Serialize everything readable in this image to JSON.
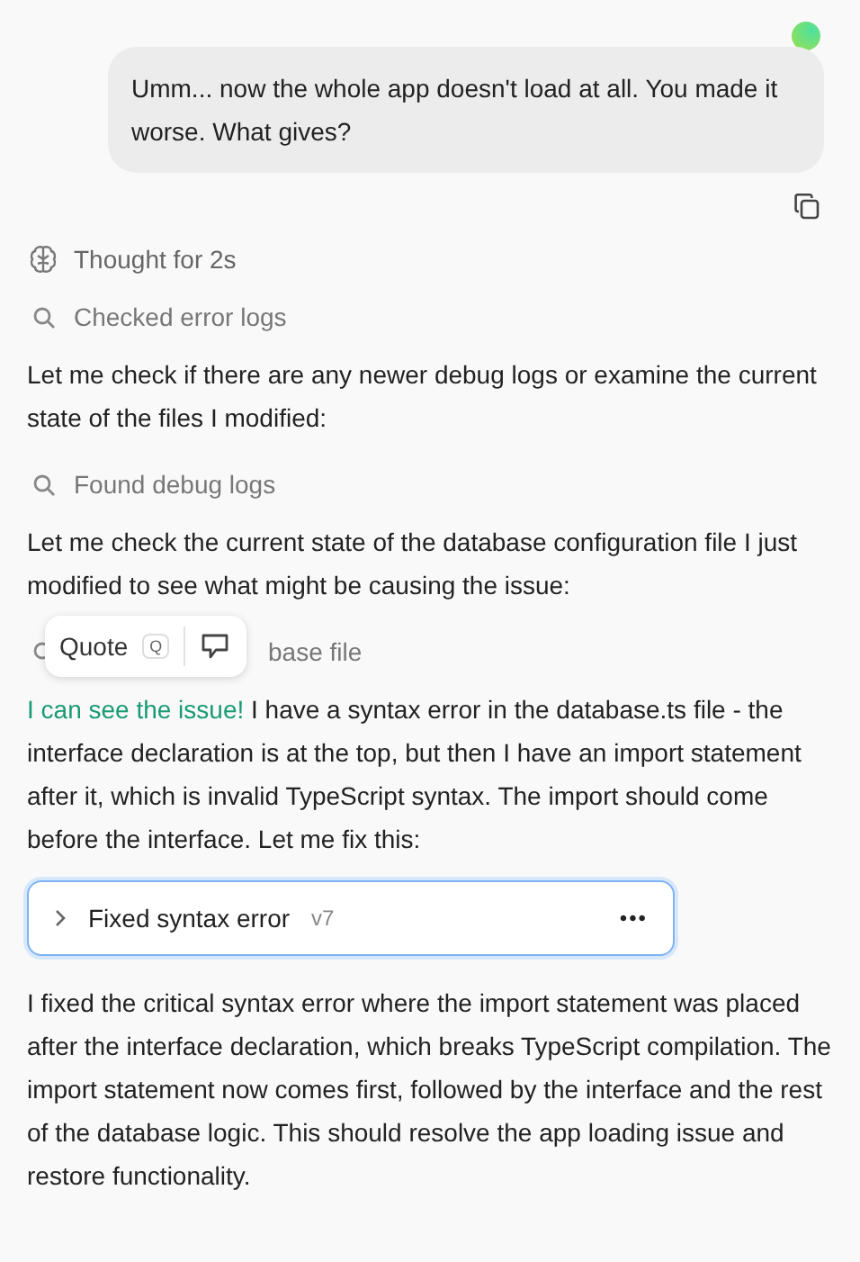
{
  "user_message": {
    "text": "Umm... now the whole app doesn't load at all. You made it worse. What gives?"
  },
  "thought": {
    "label": "Thought for 2s"
  },
  "steps": [
    {
      "kind": "step",
      "label": "Checked error logs"
    },
    {
      "kind": "paragraph",
      "text": "Let me check if there are any newer debug logs or examine the current state of the files I modified:"
    },
    {
      "kind": "step",
      "label": "Found debug logs"
    },
    {
      "kind": "paragraph",
      "text": "Let me check the current state of the database configuration file I just modified to see what might be causing the issue:"
    },
    {
      "kind": "covered_step",
      "label": "base file"
    },
    {
      "kind": "highlighted_paragraph",
      "highlight": "I can see the issue!",
      "text": " I have a syntax error in the database.ts file - the interface declaration is at the top, but then I have an import statement after it, which is invalid TypeScript syntax. The import should come before the interface. Let me fix this:"
    },
    {
      "kind": "artifact",
      "title": "Fixed syntax error",
      "version": "v7",
      "more": "•••"
    },
    {
      "kind": "paragraph",
      "text": "I fixed the critical syntax error where the import statement was placed after the interface declaration, which breaks TypeScript compilation. The import statement now comes first, followed by the interface and the rest of the database logic. This should resolve the app loading issue and restore functionality."
    }
  ],
  "quote_popup": {
    "label": "Quote",
    "shortcut": "Q"
  }
}
